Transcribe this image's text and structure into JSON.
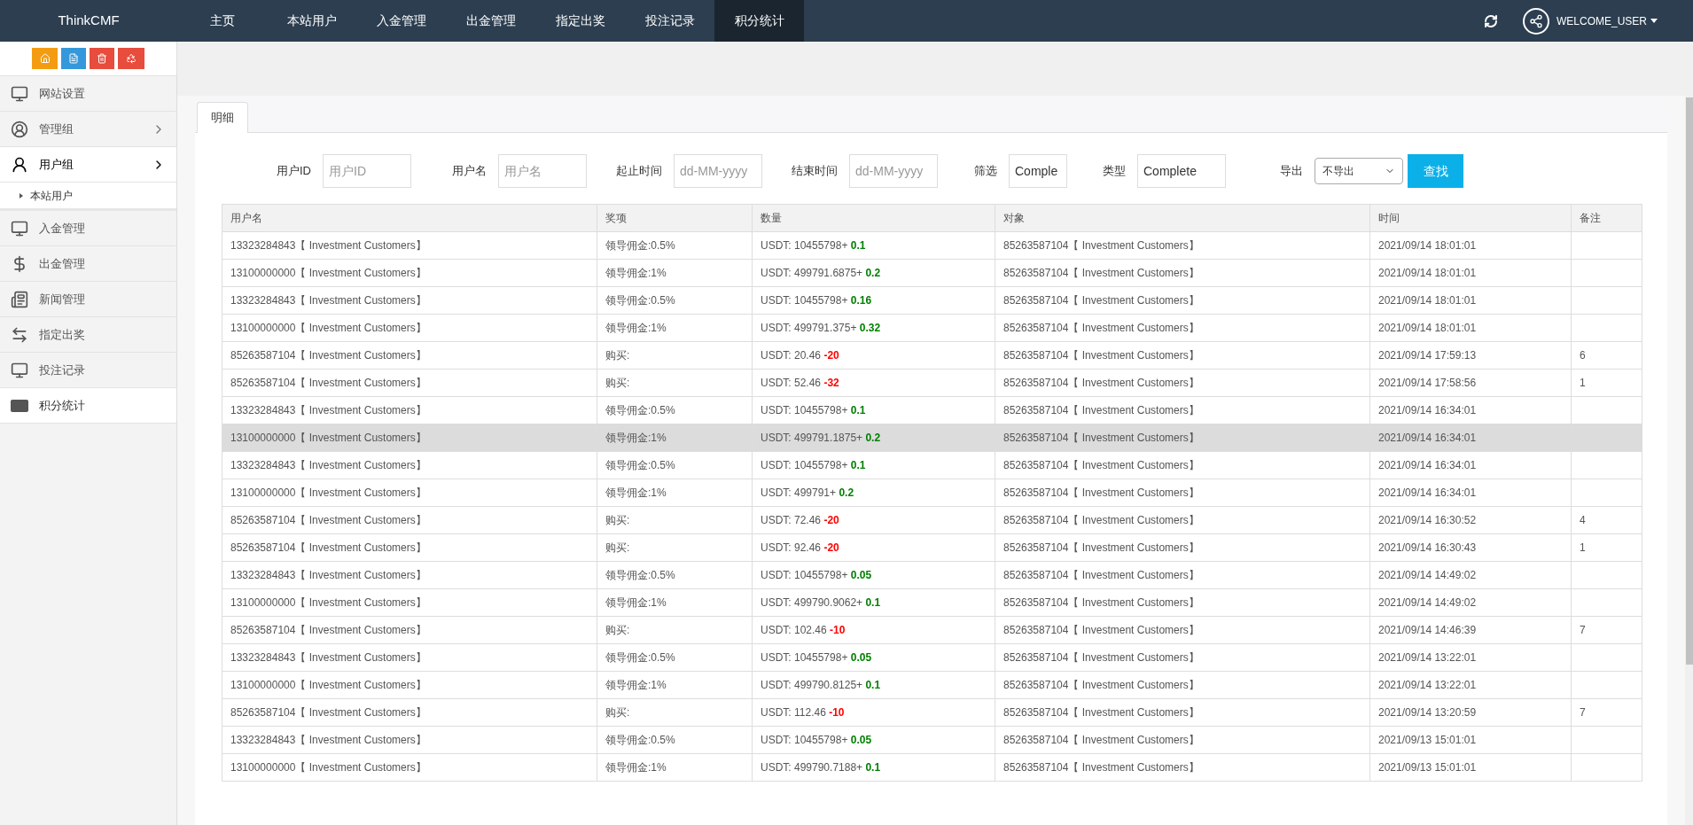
{
  "brand": "ThinkCMF",
  "nav": [
    {
      "label": "主页",
      "selected": false
    },
    {
      "label": "本站用户",
      "selected": false
    },
    {
      "label": "入金管理",
      "selected": false
    },
    {
      "label": "出金管理",
      "selected": false
    },
    {
      "label": "指定出奖",
      "selected": false
    },
    {
      "label": "投注记录",
      "selected": false
    },
    {
      "label": "积分统计",
      "selected": true
    }
  ],
  "user_menu": {
    "label": "WELCOME_USER"
  },
  "sidebar": {
    "items": [
      {
        "label": "网站设置",
        "kind": "link",
        "selected": false
      },
      {
        "label": "管理组",
        "kind": "group",
        "expanded": false,
        "selected": false
      },
      {
        "label": "用户组",
        "kind": "group",
        "expanded": true,
        "selected": false,
        "children": [
          {
            "label": "本站用户",
            "selected": false
          }
        ]
      },
      {
        "label": "入金管理",
        "kind": "link",
        "selected": false
      },
      {
        "label": "出金管理",
        "kind": "link",
        "selected": false
      },
      {
        "label": "新闻管理",
        "kind": "link",
        "selected": false
      },
      {
        "label": "指定出奖",
        "kind": "link",
        "selected": false
      },
      {
        "label": "投注记录",
        "kind": "link",
        "selected": false
      },
      {
        "label": "积分统计",
        "kind": "link",
        "selected": true
      }
    ]
  },
  "tabs": [
    {
      "label": "明细",
      "selected": true
    }
  ],
  "filters": [
    {
      "label": "用户ID",
      "kind": "input",
      "placeholder": "用户ID"
    },
    {
      "label": "用户名",
      "kind": "input",
      "placeholder": "用户名"
    },
    {
      "label": "起止时间",
      "kind": "input",
      "placeholder": "dd-MM-yyyy"
    },
    {
      "label": "结束时间",
      "kind": "input",
      "placeholder": "dd-MM-yyyy"
    },
    {
      "label": "筛选",
      "kind": "input",
      "value": "Comple"
    },
    {
      "label": "类型",
      "kind": "input",
      "value": "Complete"
    },
    {
      "label": "导出",
      "kind": "select",
      "value": "不导出"
    }
  ],
  "search_button": "查找",
  "table": {
    "columns": [
      "用户名",
      "奖项",
      "数量",
      "对象",
      "时间",
      "备注"
    ],
    "rows": [
      {
        "user": "13323284843【 Investment Customers】",
        "prize": "领导佣金:0.5%",
        "amount": "USDT: 10455798+",
        "change": "0.1",
        "color": "#008000",
        "target": "85263587104【 Investment Customers】",
        "time": "2021/09/14 18:01:01",
        "selected": false
      },
      {
        "user": "13100000000【 Investment Customers】",
        "prize": "领导佣金:1%",
        "amount": "USDT: 499791.6875+",
        "change": "0.2",
        "color": "#008000",
        "target": "85263587104【 Investment Customers】",
        "time": "2021/09/14 18:01:01",
        "selected": false
      },
      {
        "user": "13323284843【 Investment Customers】",
        "prize": "领导佣金:0.5%",
        "amount": "USDT: 10455798+",
        "change": "0.16",
        "color": "#008000",
        "target": "85263587104【 Investment Customers】",
        "time": "2021/09/14 18:01:01",
        "selected": false
      },
      {
        "user": "13100000000【 Investment Customers】",
        "prize": "领导佣金:1%",
        "amount": "USDT: 499791.375+",
        "change": "0.32",
        "color": "#008000",
        "target": "85263587104【 Investment Customers】",
        "time": "2021/09/14 18:01:01",
        "selected": false
      },
      {
        "user": "85263587104【 Investment Customers】",
        "prize": "购买:",
        "amount": "USDT: 20.46",
        "change": "-20",
        "color": "#ff0000",
        "target": "85263587104【 Investment Customers】",
        "time": "2021/09/14 17:59:13",
        "note": "6",
        "selected": false
      },
      {
        "user": "85263587104【 Investment Customers】",
        "prize": "购买:",
        "amount": "USDT: 52.46",
        "change": "-32",
        "color": "#ff0000",
        "target": "85263587104【 Investment Customers】",
        "time": "2021/09/14 17:58:56",
        "note": "1",
        "selected": false
      },
      {
        "user": "13323284843【 Investment Customers】",
        "prize": "领导佣金:0.5%",
        "amount": "USDT: 10455798+",
        "change": "0.1",
        "color": "#008000",
        "target": "85263587104【 Investment Customers】",
        "time": "2021/09/14 16:34:01",
        "selected": false
      },
      {
        "user": "13100000000【 Investment Customers】",
        "prize": "领导佣金:1%",
        "amount": "USDT: 499791.1875+",
        "change": "0.2",
        "color": "#008000",
        "target": "85263587104【 Investment Customers】",
        "time": "2021/09/14 16:34:01",
        "selected": true
      },
      {
        "user": "13323284843【 Investment Customers】",
        "prize": "领导佣金:0.5%",
        "amount": "USDT: 10455798+",
        "change": "0.1",
        "color": "#008000",
        "target": "85263587104【 Investment Customers】",
        "time": "2021/09/14 16:34:01",
        "selected": false
      },
      {
        "user": "13100000000【 Investment Customers】",
        "prize": "领导佣金:1%",
        "amount": "USDT: 499791+",
        "change": "0.2",
        "color": "#008000",
        "target": "85263587104【 Investment Customers】",
        "time": "2021/09/14 16:34:01",
        "selected": false
      },
      {
        "user": "85263587104【 Investment Customers】",
        "prize": "购买:",
        "amount": "USDT: 72.46",
        "change": "-20",
        "color": "#ff0000",
        "target": "85263587104【 Investment Customers】",
        "time": "2021/09/14 16:30:52",
        "note": "4",
        "selected": false
      },
      {
        "user": "85263587104【 Investment Customers】",
        "prize": "购买:",
        "amount": "USDT: 92.46",
        "change": "-20",
        "color": "#ff0000",
        "target": "85263587104【 Investment Customers】",
        "time": "2021/09/14 16:30:43",
        "note": "1",
        "selected": false
      },
      {
        "user": "13323284843【 Investment Customers】",
        "prize": "领导佣金:0.5%",
        "amount": "USDT: 10455798+",
        "change": "0.05",
        "color": "#008000",
        "target": "85263587104【 Investment Customers】",
        "time": "2021/09/14 14:49:02",
        "selected": false
      },
      {
        "user": "13100000000【 Investment Customers】",
        "prize": "领导佣金:1%",
        "amount": "USDT: 499790.9062+",
        "change": "0.1",
        "color": "#008000",
        "target": "85263587104【 Investment Customers】",
        "time": "2021/09/14 14:49:02",
        "selected": false
      },
      {
        "user": "85263587104【 Investment Customers】",
        "prize": "购买:",
        "amount": "USDT: 102.46",
        "change": "-10",
        "color": "#ff0000",
        "target": "85263587104【 Investment Customers】",
        "time": "2021/09/14 14:46:39",
        "note": "7",
        "selected": false
      },
      {
        "user": "13323284843【 Investment Customers】",
        "prize": "领导佣金:0.5%",
        "amount": "USDT: 10455798+",
        "change": "0.05",
        "color": "#008000",
        "target": "85263587104【 Investment Customers】",
        "time": "2021/09/14 13:22:01",
        "selected": false
      },
      {
        "user": "13100000000【 Investment Customers】",
        "prize": "领导佣金:1%",
        "amount": "USDT: 499790.8125+",
        "change": "0.1",
        "color": "#008000",
        "target": "85263587104【 Investment Customers】",
        "time": "2021/09/14 13:22:01",
        "selected": false
      },
      {
        "user": "85263587104【 Investment Customers】",
        "prize": "购买:",
        "amount": "USDT: 112.46",
        "change": "-10",
        "color": "#ff0000",
        "target": "85263587104【 Investment Customers】",
        "time": "2021/09/14 13:20:59",
        "note": "7",
        "selected": false
      },
      {
        "user": "13323284843【 Investment Customers】",
        "prize": "领导佣金:0.5%",
        "amount": "USDT: 10455798+",
        "change": "0.05",
        "color": "#008000",
        "target": "85263587104【 Investment Customers】",
        "time": "2021/09/13 15:01:01",
        "selected": false
      },
      {
        "user": "13100000000【 Investment Customers】",
        "prize": "领导佣金:1%",
        "amount": "USDT: 499790.7188+",
        "change": "0.1",
        "color": "#008000",
        "target": "85263587104【 Investment Customers】",
        "time": "2021/09/13 15:01:01",
        "selected": false
      }
    ]
  }
}
